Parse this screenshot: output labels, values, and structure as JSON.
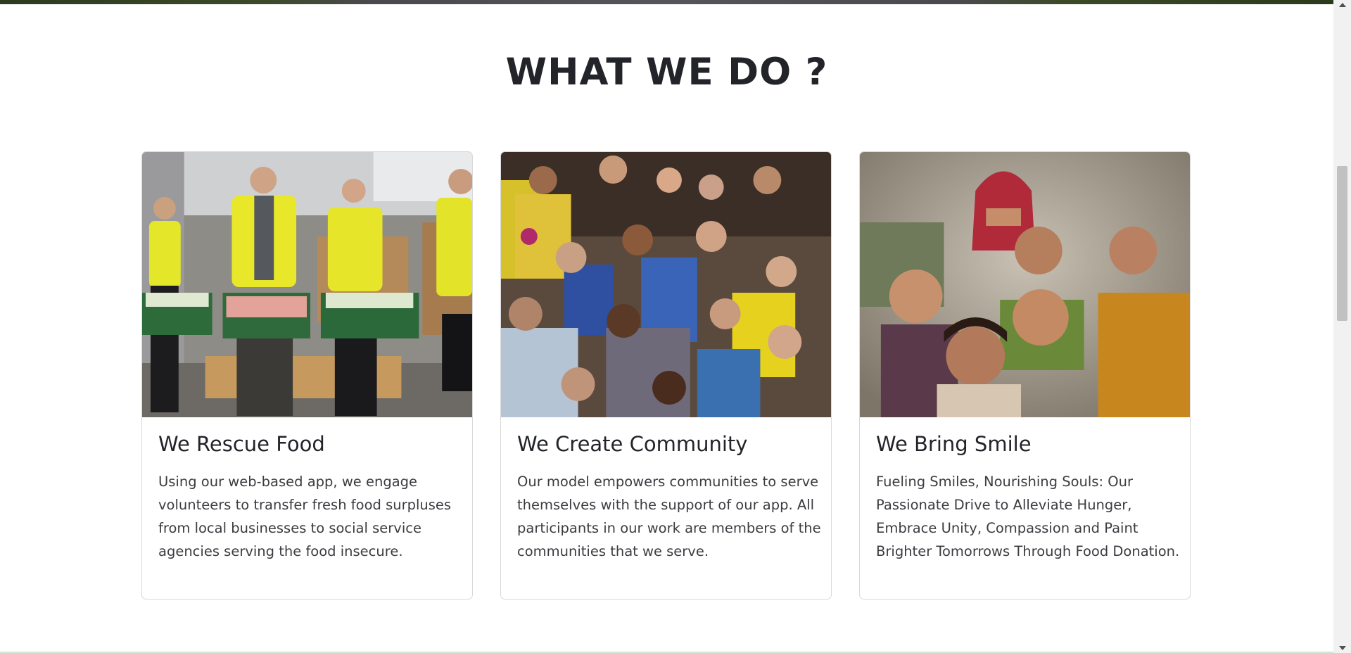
{
  "section": {
    "title": "WHAT WE DO ?"
  },
  "cards": [
    {
      "title": "We Rescue Food",
      "text": "Using our web-based app, we engage volunteers to transfer fresh food surpluses from local businesses to social service agencies serving the food insecure.",
      "image_icon": "volunteers-with-food-crates-photo"
    },
    {
      "title": "We Create Community",
      "text": "Our model empowers communities to serve themselves with the support of our app. All participants in our work are members of the communities that we serve.",
      "image_icon": "cheering-crowd-photo"
    },
    {
      "title": "We Bring Smile",
      "text": "Fueling Smiles, Nourishing Souls: Our Passionate Drive to Alleviate Hunger, Embrace Unity, Compassion and Paint Brighter Tomorrows Through Food Donation.",
      "image_icon": "smiling-children-photo"
    }
  ],
  "colors": {
    "heading": "#222429",
    "body_text": "#3a3c40",
    "card_border": "#d9d9dc",
    "vest_yellow": "#e6e61e",
    "crate_green": "#2d6b3a"
  }
}
